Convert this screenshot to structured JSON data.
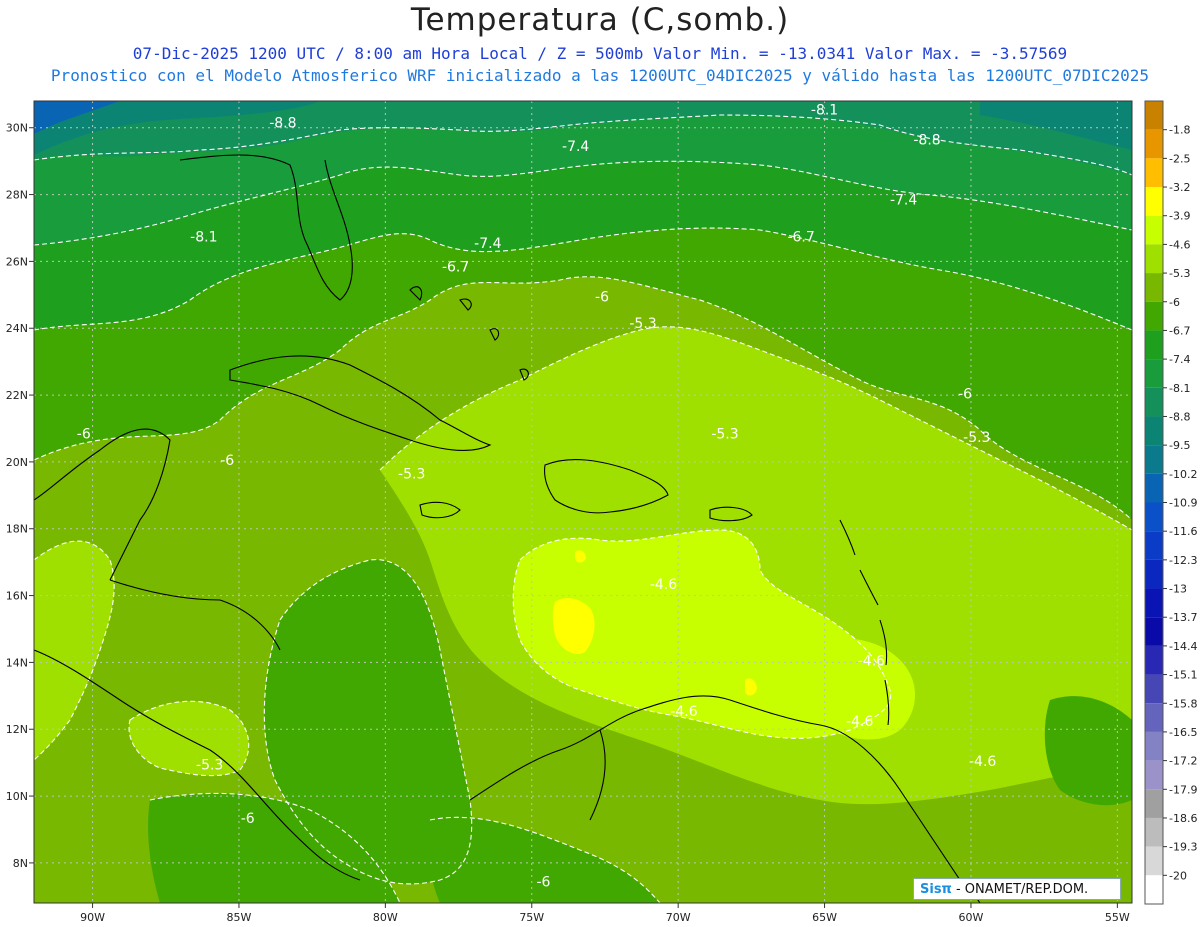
{
  "title": "Temperatura (C,somb.)",
  "subtitle_line1": "07-Dic-2025   1200 UTC / 8:00 am Hora Local / Z = 500mb  Valor Min. = -13.0341  Valor Max. = -3.57569",
  "subtitle_line2": "Pronostico con el Modelo Atmosferico WRF inicializado a las 1200UTC_04DIC2025 y válido hasta las  1200UTC_07DIC2025",
  "credit": {
    "logo": "Sisπ",
    "text": " - ONAMET/REP.DOM."
  },
  "map": {
    "lon_range": [
      -92,
      -54.5
    ],
    "lat_range": [
      6.8,
      30.8
    ],
    "lon_ticks": [
      {
        "value": -90,
        "label": "90W"
      },
      {
        "value": -85,
        "label": "85W"
      },
      {
        "value": -80,
        "label": "80W"
      },
      {
        "value": -75,
        "label": "75W"
      },
      {
        "value": -70,
        "label": "70W"
      },
      {
        "value": -65,
        "label": "65W"
      },
      {
        "value": -60,
        "label": "60W"
      },
      {
        "value": -55,
        "label": "55W"
      }
    ],
    "lat_ticks": [
      {
        "value": 30,
        "label": "30N"
      },
      {
        "value": 28,
        "label": "28N"
      },
      {
        "value": 26,
        "label": "26N"
      },
      {
        "value": 24,
        "label": "24N"
      },
      {
        "value": 22,
        "label": "22N"
      },
      {
        "value": 20,
        "label": "20N"
      },
      {
        "value": 18,
        "label": "18N"
      },
      {
        "value": 16,
        "label": "16N"
      },
      {
        "value": 14,
        "label": "14N"
      },
      {
        "value": 12,
        "label": "12N"
      },
      {
        "value": 10,
        "label": "10N"
      },
      {
        "value": 8,
        "label": "8N"
      }
    ],
    "grid_dashed": true,
    "contour_labels": [
      {
        "lon": -83.5,
        "lat": 30.0,
        "text": "-8.8"
      },
      {
        "lon": -65.0,
        "lat": 30.4,
        "text": "-8.1"
      },
      {
        "lon": -73.5,
        "lat": 29.3,
        "text": "-7.4"
      },
      {
        "lon": -61.5,
        "lat": 29.5,
        "text": "-8.8"
      },
      {
        "lon": -86.2,
        "lat": 26.6,
        "text": "-8.1"
      },
      {
        "lon": -62.3,
        "lat": 27.7,
        "text": "-7.4"
      },
      {
        "lon": -76.5,
        "lat": 26.4,
        "text": "-7.4"
      },
      {
        "lon": -65.8,
        "lat": 26.6,
        "text": "-6.7"
      },
      {
        "lon": -77.6,
        "lat": 25.7,
        "text": "-6.7"
      },
      {
        "lon": -72.6,
        "lat": 24.8,
        "text": "-6"
      },
      {
        "lon": -71.2,
        "lat": 24.0,
        "text": "-5.3"
      },
      {
        "lon": -60.2,
        "lat": 21.9,
        "text": "-6"
      },
      {
        "lon": -90.3,
        "lat": 20.7,
        "text": "-6"
      },
      {
        "lon": -68.4,
        "lat": 20.7,
        "text": "-5.3"
      },
      {
        "lon": -59.8,
        "lat": 20.6,
        "text": "-5.3"
      },
      {
        "lon": -85.4,
        "lat": 19.9,
        "text": "-6"
      },
      {
        "lon": -79.1,
        "lat": 19.5,
        "text": "-5.3"
      },
      {
        "lon": -70.5,
        "lat": 16.2,
        "text": "-4.6"
      },
      {
        "lon": -63.4,
        "lat": 13.9,
        "text": "-4.6"
      },
      {
        "lon": -69.8,
        "lat": 12.4,
        "text": "-4.6"
      },
      {
        "lon": -63.8,
        "lat": 12.1,
        "text": "-4.6"
      },
      {
        "lon": -86.0,
        "lat": 10.8,
        "text": "-5.3"
      },
      {
        "lon": -59.6,
        "lat": 10.9,
        "text": "-4.6"
      },
      {
        "lon": -84.7,
        "lat": 9.2,
        "text": "-6"
      },
      {
        "lon": -74.6,
        "lat": 7.3,
        "text": "-6"
      }
    ]
  },
  "colorbar": {
    "labels": [
      "-1.8",
      "-2.5",
      "-3.2",
      "-3.9",
      "-4.6",
      "-5.3",
      "-6",
      "-6.7",
      "-7.4",
      "-8.1",
      "-8.8",
      "-9.5",
      "-10.2",
      "-10.9",
      "-11.6",
      "-12.3",
      "-13",
      "-13.7",
      "-14.4",
      "-15.1",
      "-15.8",
      "-16.5",
      "-17.2",
      "-17.9",
      "-18.6",
      "-19.3",
      "-20"
    ],
    "colors": [
      "#c88200",
      "#e89600",
      "#ffbe00",
      "#ffff00",
      "#c8ff00",
      "#a0e000",
      "#78b800",
      "#40a800",
      "#1ea01e",
      "#189c3c",
      "#14905a",
      "#0c8474",
      "#0a7a8c",
      "#0a64b4",
      "#0a50c8",
      "#0a3cc8",
      "#0a28c0",
      "#0a14b4",
      "#0a0aa8",
      "#2828b4",
      "#4646b4",
      "#6464bc",
      "#8282c4",
      "#9a92c8",
      "#a0a0a0",
      "#bcbcbc",
      "#d8d8d8",
      "#ffffff"
    ]
  },
  "colors": {
    "land_outline": "#000000",
    "grid": "#b8c8b8",
    "contour": "#ffffff"
  }
}
